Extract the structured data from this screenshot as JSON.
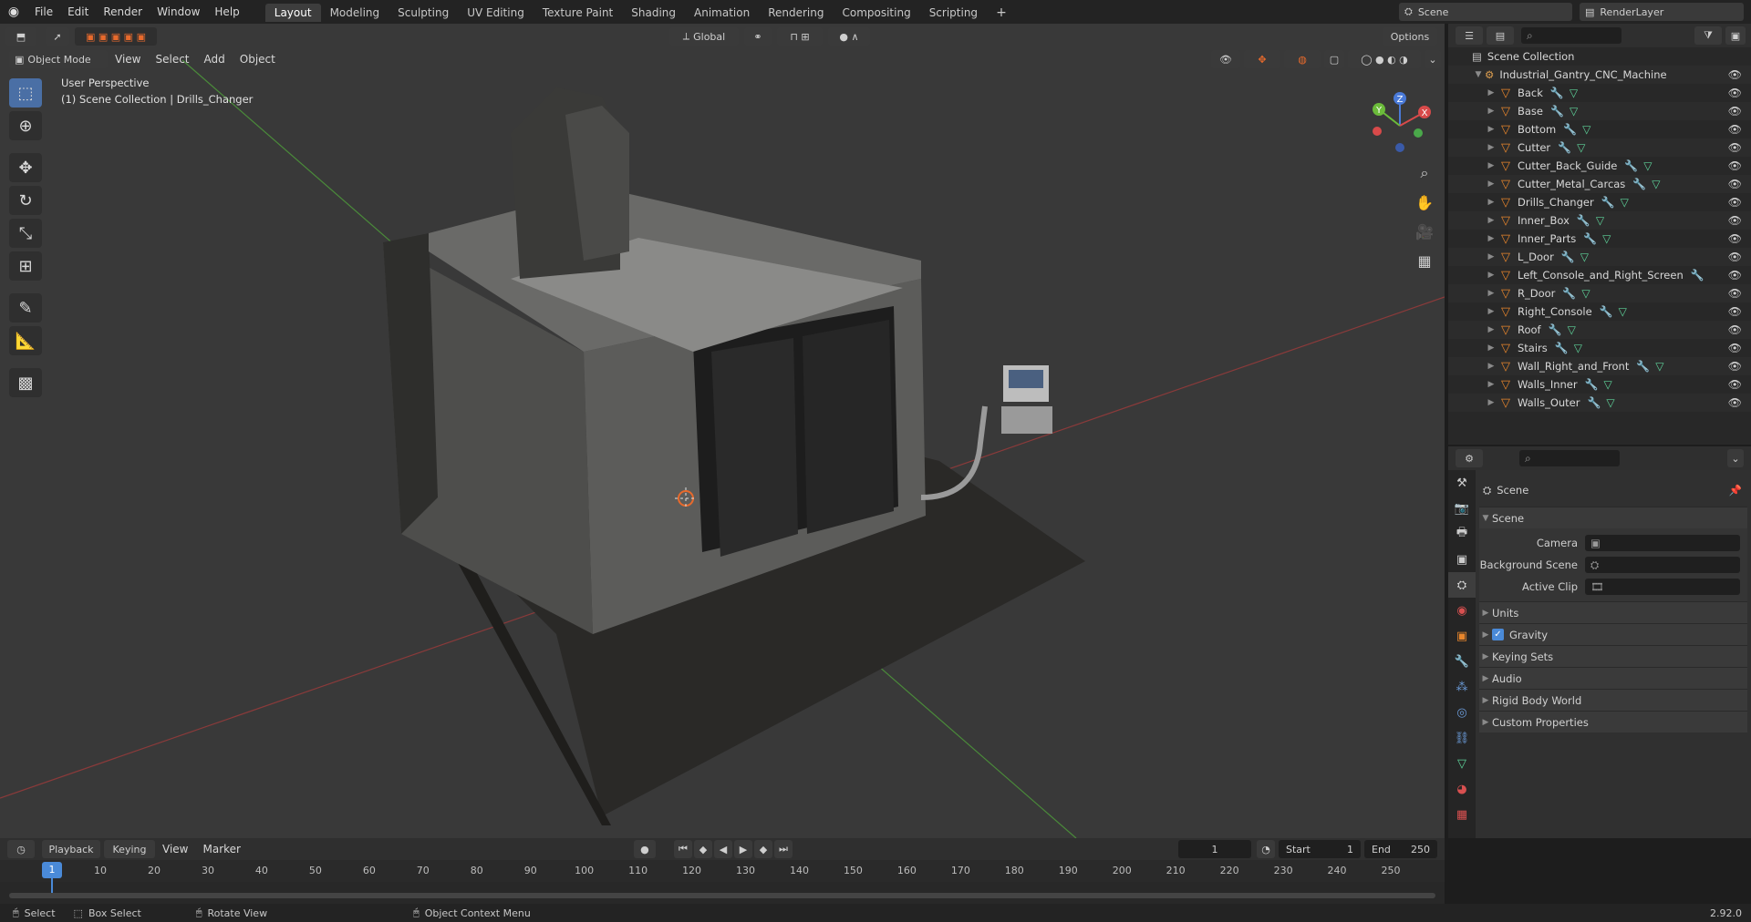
{
  "topbar": {
    "menus": [
      "File",
      "Edit",
      "Render",
      "Window",
      "Help"
    ],
    "workspaces": [
      "Layout",
      "Modeling",
      "Sculpting",
      "UV Editing",
      "Texture Paint",
      "Shading",
      "Animation",
      "Rendering",
      "Compositing",
      "Scripting"
    ],
    "active_workspace": "Layout",
    "scene_name": "Scene",
    "renderlayer_name": "RenderLayer"
  },
  "viewport": {
    "mode": "Object Mode",
    "menus": [
      "View",
      "Select",
      "Add",
      "Object"
    ],
    "transform_orientation": "Global",
    "options_label": "Options",
    "overlay_line1": "User Perspective",
    "overlay_line2": "(1) Scene Collection | Drills_Changer",
    "gizmo": {
      "x": "X",
      "y": "Y",
      "z": "Z"
    }
  },
  "outliner": {
    "root": "Scene Collection",
    "collection": "Industrial_Gantry_CNC_Machine",
    "items": [
      {
        "name": "Back",
        "mesh": true
      },
      {
        "name": "Base",
        "mesh": true
      },
      {
        "name": "Bottom",
        "mesh": true
      },
      {
        "name": "Cutter",
        "mesh": true
      },
      {
        "name": "Cutter_Back_Guide",
        "mesh": true
      },
      {
        "name": "Cutter_Metal_Carcas",
        "mesh": true
      },
      {
        "name": "Drills_Changer",
        "mesh": true
      },
      {
        "name": "Inner_Box",
        "mesh": true
      },
      {
        "name": "Inner_Parts",
        "mesh": true
      },
      {
        "name": "L_Door",
        "mesh": true
      },
      {
        "name": "Left_Console_and_Right_Screen",
        "mesh": false
      },
      {
        "name": "R_Door",
        "mesh": true
      },
      {
        "name": "Right_Console",
        "mesh": true
      },
      {
        "name": "Roof",
        "mesh": true
      },
      {
        "name": "Stairs",
        "mesh": true
      },
      {
        "name": "Wall_Right_and_Front",
        "mesh": true
      },
      {
        "name": "Walls_Inner",
        "mesh": true
      },
      {
        "name": "Walls_Outer",
        "mesh": true
      }
    ]
  },
  "properties": {
    "context_title": "Scene",
    "panel_title": "Scene",
    "camera_label": "Camera",
    "background_scene_label": "Background Scene",
    "active_clip_label": "Active Clip",
    "subpanels": [
      "Units",
      "Gravity",
      "Keying Sets",
      "Audio",
      "Rigid Body World",
      "Custom Properties"
    ],
    "gravity_checked": true
  },
  "timeline": {
    "menus": [
      "Playback",
      "Keying",
      "View",
      "Marker"
    ],
    "current_frame": "1",
    "start_label": "Start",
    "start_value": "1",
    "end_label": "End",
    "end_value": "250",
    "ruler": [
      "1",
      "10",
      "20",
      "30",
      "40",
      "50",
      "60",
      "70",
      "80",
      "90",
      "100",
      "110",
      "120",
      "130",
      "140",
      "150",
      "160",
      "170",
      "180",
      "190",
      "200",
      "210",
      "220",
      "230",
      "240",
      "250"
    ]
  },
  "statusbar": {
    "select": "Select",
    "box_select": "Box Select",
    "rotate_view": "Rotate View",
    "context_menu": "Object Context Menu",
    "version": "2.92.0"
  }
}
